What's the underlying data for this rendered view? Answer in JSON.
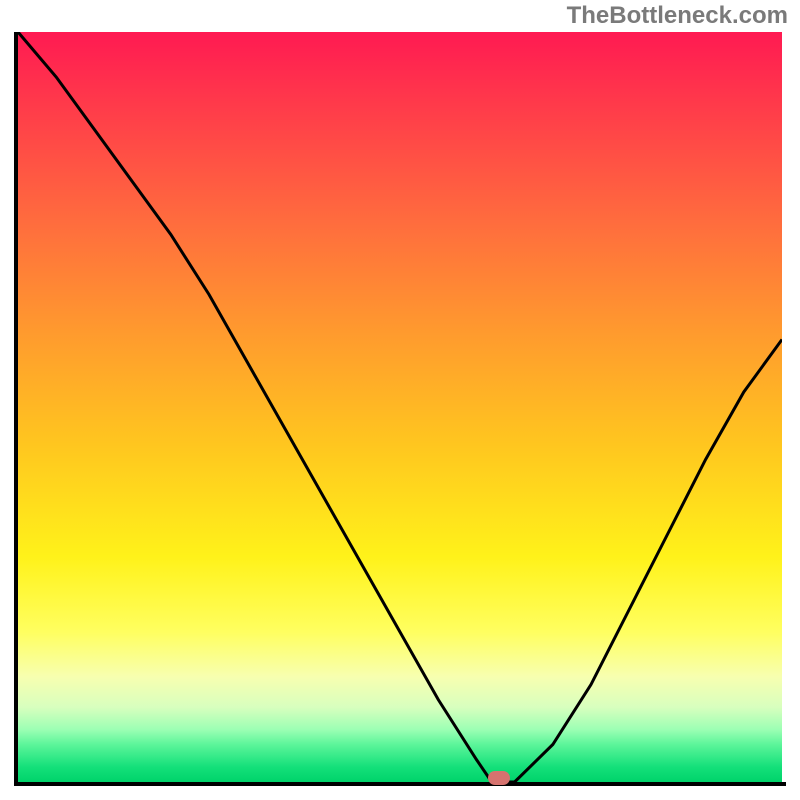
{
  "attribution": "TheBottleneck.com",
  "chart_data": {
    "type": "line",
    "title": "",
    "xlabel": "",
    "ylabel": "",
    "xlim": [
      0,
      100
    ],
    "ylim": [
      0,
      100
    ],
    "x": [
      0,
      5,
      10,
      15,
      20,
      25,
      30,
      35,
      40,
      45,
      50,
      55,
      60,
      62,
      65,
      70,
      75,
      80,
      85,
      90,
      95,
      100
    ],
    "y": [
      100,
      94,
      87,
      80,
      73,
      65,
      56,
      47,
      38,
      29,
      20,
      11,
      3,
      0,
      0,
      5,
      13,
      23,
      33,
      43,
      52,
      59
    ],
    "marker_x": 63,
    "marker_y": 0
  },
  "colors": {
    "curve": "#000000",
    "marker": "#d6736f",
    "axis": "#000000"
  }
}
